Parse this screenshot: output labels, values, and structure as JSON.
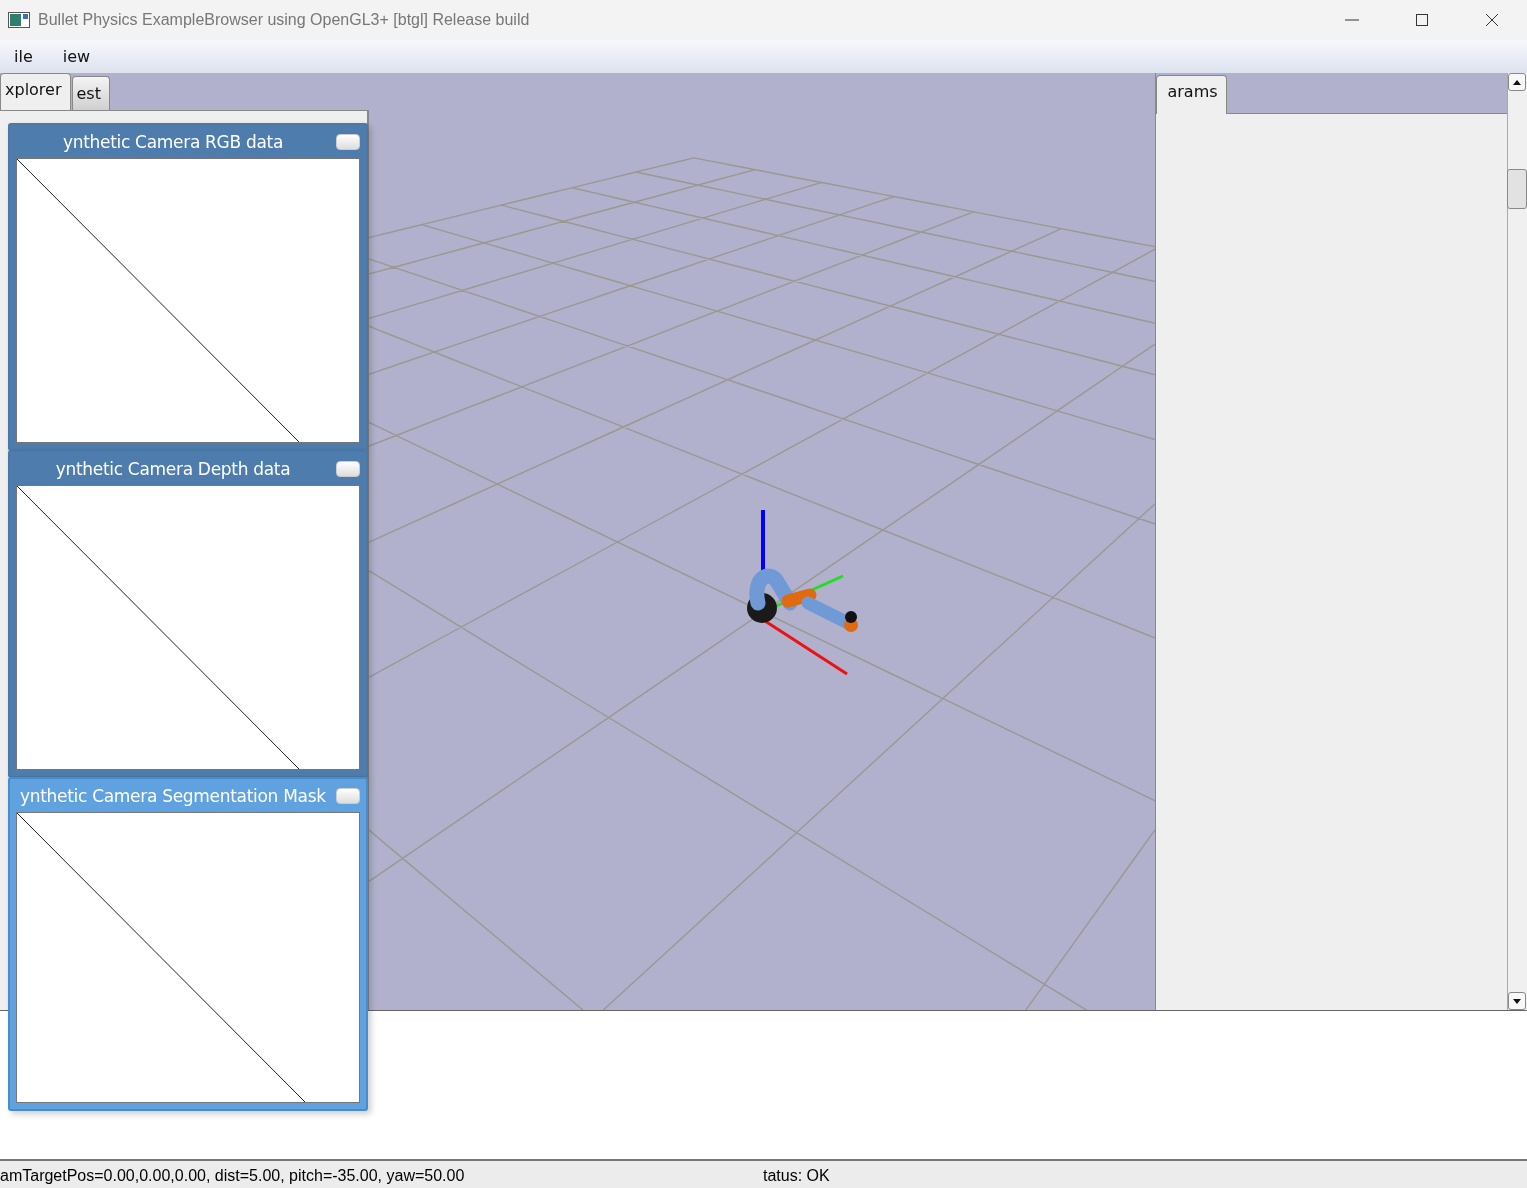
{
  "window": {
    "title": "Bullet Physics ExampleBrowser using OpenGL3+ [btgl] Release build"
  },
  "menu": [
    "ile",
    "iew"
  ],
  "left_tabs": [
    {
      "label": "xplorer",
      "selected": true
    },
    {
      "label": "est",
      "selected": false
    }
  ],
  "viewport": {
    "kind": "picture"
  },
  "camera_windows": [
    {
      "title": "ynthetic Camera RGB data",
      "active": false
    },
    {
      "title": "ynthetic Camera Depth data",
      "active": false
    },
    {
      "title": "ynthetic Camera Segmentation Mask",
      "active": true
    }
  ],
  "right_tabs": [
    {
      "label": "arams",
      "selected": true
    }
  ],
  "status_bar": {
    "camera": "amTargetPos=0.00,0.00,0.00, dist=5.00, pitch=-35.00, yaw=50.00",
    "status": "tatus: OK"
  }
}
